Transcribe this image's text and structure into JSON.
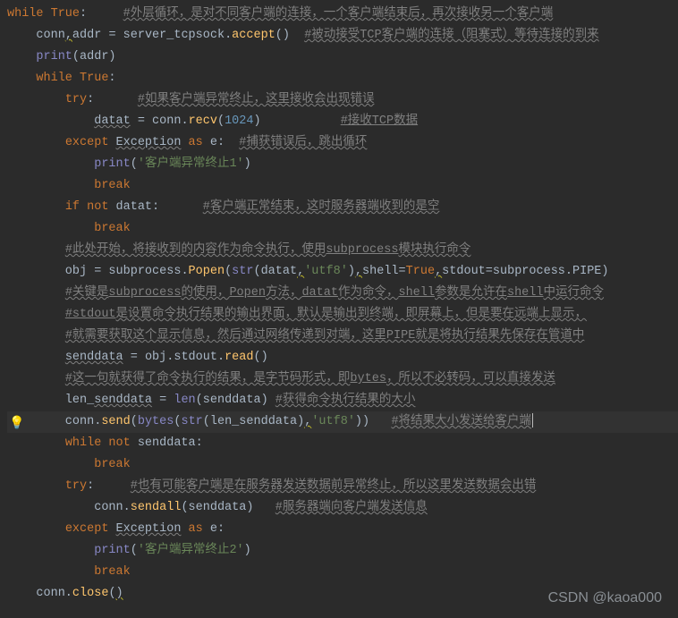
{
  "watermark": "CSDN @kaoa000",
  "bulb_line_index": 19,
  "code": {
    "lines": [
      [
        [
          "kw",
          "while "
        ],
        [
          "kw",
          "True"
        ],
        [
          "p",
          ":"
        ],
        [
          "p",
          "     "
        ],
        [
          "com wavy",
          "#外层循环，是对不同客户端的连接，一个客户端结束后，再次接收另一个客户端"
        ]
      ],
      [
        [
          "p",
          "    conn"
        ],
        [
          "warn",
          ","
        ],
        [
          "p",
          "addr "
        ],
        [
          "op",
          "="
        ],
        [
          "p",
          " server_tcpsock."
        ],
        [
          "fn",
          "accept"
        ],
        [
          "p",
          "()  "
        ],
        [
          "com wavy",
          "#被动接受TCP客户端的连接（阻塞式）等待连接的到来"
        ]
      ],
      [
        [
          "p",
          "    "
        ],
        [
          "builtin",
          "print"
        ],
        [
          "p",
          "(addr)"
        ]
      ],
      [
        [
          "p",
          "    "
        ],
        [
          "kw",
          "while "
        ],
        [
          "kw",
          "True"
        ],
        [
          "p",
          ":"
        ]
      ],
      [
        [
          "p",
          "        "
        ],
        [
          "kw",
          "try"
        ],
        [
          "p",
          ":"
        ],
        [
          "p",
          "      "
        ],
        [
          "com wavy",
          "#如果客户端异常终止，这里接收会出现错误"
        ]
      ],
      [
        [
          "p",
          "            "
        ],
        [
          "wavy",
          "datat"
        ],
        [
          "p",
          " "
        ],
        [
          "op",
          "="
        ],
        [
          "p",
          " conn."
        ],
        [
          "fn",
          "recv"
        ],
        [
          "p",
          "("
        ],
        [
          "num",
          "1024"
        ],
        [
          "p",
          ")           "
        ],
        [
          "com wavy u",
          "#接收TCP数据"
        ]
      ],
      [
        [
          "p",
          "        "
        ],
        [
          "kw",
          "except "
        ],
        [
          "p wavy",
          "Exception"
        ],
        [
          "kw",
          " as "
        ],
        [
          "p",
          "e:  "
        ],
        [
          "com wavy",
          "#捕获错误后，跳出循环"
        ]
      ],
      [
        [
          "p",
          "            "
        ],
        [
          "builtin",
          "print"
        ],
        [
          "p",
          "("
        ],
        [
          "str",
          "'客户端异常终止1'"
        ],
        [
          "p",
          ")"
        ]
      ],
      [
        [
          "p",
          "            "
        ],
        [
          "kw",
          "break"
        ]
      ],
      [
        [
          "p",
          "        "
        ],
        [
          "kw",
          "if not "
        ],
        [
          "p",
          "datat:      "
        ],
        [
          "com wavy",
          "#客户端正常结束，这时服务器端收到的是空"
        ]
      ],
      [
        [
          "p",
          "            "
        ],
        [
          "kw",
          "break"
        ]
      ],
      [
        [
          "p",
          "        "
        ],
        [
          "com wavy",
          "#此处开始，将接收到的内容作为命令执行，使用"
        ],
        [
          "com wavy u",
          "subprocess"
        ],
        [
          "com wavy",
          "模块执行命令"
        ]
      ],
      [
        [
          "p",
          "        obj "
        ],
        [
          "op",
          "="
        ],
        [
          "p",
          " subprocess."
        ],
        [
          "fn",
          "Popen"
        ],
        [
          "p",
          "("
        ],
        [
          "builtin",
          "str"
        ],
        [
          "p",
          "(datat"
        ],
        [
          "warn",
          ","
        ],
        [
          "str",
          "'utf8'"
        ],
        [
          "p",
          ")"
        ],
        [
          "warn",
          ","
        ],
        [
          "p",
          "shell"
        ],
        [
          "op",
          "="
        ],
        [
          "kw",
          "True"
        ],
        [
          "warn",
          ","
        ],
        [
          "p",
          "stdout"
        ],
        [
          "op",
          "="
        ],
        [
          "p",
          "subprocess.PIPE)"
        ]
      ],
      [
        [
          "p",
          "        "
        ],
        [
          "com wavy",
          "#关键是"
        ],
        [
          "com wavy u",
          "subprocess"
        ],
        [
          "com wavy",
          "的使用，"
        ],
        [
          "com wavy u",
          "Popen"
        ],
        [
          "com wavy",
          "方法，"
        ],
        [
          "com wavy u",
          "datat"
        ],
        [
          "com wavy",
          "作为命令，"
        ],
        [
          "com wavy u",
          "shell"
        ],
        [
          "com wavy",
          "参数是允许在"
        ],
        [
          "com wavy u",
          "shell"
        ],
        [
          "com wavy",
          "中运行命令"
        ]
      ],
      [
        [
          "p",
          "        "
        ],
        [
          "com wavy u",
          "#stdout"
        ],
        [
          "com wavy",
          "是设置命令执行结果的输出界面，默认是输出到终端，即屏幕上，但是要在远端上显示，"
        ]
      ],
      [
        [
          "p",
          "        "
        ],
        [
          "com wavy",
          "#就需要获取这个显示信息，然后通过网络传递到对端，这里PIPE就是将执行结果先保存在管道中"
        ]
      ],
      [
        [
          "p",
          "        "
        ],
        [
          "p wavy",
          "senddata"
        ],
        [
          "p",
          " "
        ],
        [
          "op",
          "="
        ],
        [
          "p",
          " obj.stdout."
        ],
        [
          "fn",
          "read"
        ],
        [
          "p",
          "()"
        ]
      ],
      [
        [
          "p",
          "        "
        ],
        [
          "com wavy",
          "#这一句就获得了命令执行的结果，是字节码形式，即"
        ],
        [
          "com wavy u",
          "bytes"
        ],
        [
          "com wavy",
          "，所以不必转码，可以直接发送"
        ]
      ],
      [
        [
          "p",
          "        len_"
        ],
        [
          "p wavy",
          "senddata"
        ],
        [
          "p",
          " "
        ],
        [
          "op",
          "="
        ],
        [
          "p",
          " "
        ],
        [
          "builtin",
          "len"
        ],
        [
          "p",
          "(senddata) "
        ],
        [
          "com wavy",
          "#获得命令执行结果的大小"
        ]
      ],
      [
        [
          "p",
          "        conn."
        ],
        [
          "fn",
          "send"
        ],
        [
          "p",
          "("
        ],
        [
          "builtin",
          "bytes"
        ],
        [
          "p",
          "("
        ],
        [
          "builtin",
          "str"
        ],
        [
          "p",
          "(len_senddata)"
        ],
        [
          "warn",
          ","
        ],
        [
          "str",
          "'utf8'"
        ],
        [
          "p",
          "))   "
        ],
        [
          "com wavy",
          "#将结果大小发送给客户端"
        ],
        [
          "caret",
          ""
        ]
      ],
      [
        [
          "p",
          "        "
        ],
        [
          "kw",
          "while not "
        ],
        [
          "p",
          "senddata:"
        ]
      ],
      [
        [
          "p",
          "            "
        ],
        [
          "kw",
          "break"
        ]
      ],
      [
        [
          "p",
          "        "
        ],
        [
          "kw",
          "try"
        ],
        [
          "p",
          ":"
        ],
        [
          "p",
          "     "
        ],
        [
          "com wavy",
          "#也有可能客户端是在服务器发送数据前异常终止，所以这里发送数据会出错"
        ]
      ],
      [
        [
          "p",
          "            conn."
        ],
        [
          "fn",
          "sendall"
        ],
        [
          "p",
          "(senddata)   "
        ],
        [
          "com wavy",
          "#服务器端向客户端发送信息"
        ]
      ],
      [
        [
          "p",
          "        "
        ],
        [
          "kw",
          "except "
        ],
        [
          "p wavy",
          "Exception"
        ],
        [
          "kw",
          " as "
        ],
        [
          "p",
          "e:"
        ]
      ],
      [
        [
          "p",
          "            "
        ],
        [
          "builtin",
          "print"
        ],
        [
          "p",
          "("
        ],
        [
          "str",
          "'客户端异常终止2'"
        ],
        [
          "p",
          ")"
        ]
      ],
      [
        [
          "p",
          "            "
        ],
        [
          "kw",
          "break"
        ]
      ],
      [
        [
          "p",
          "    conn."
        ],
        [
          "fn",
          "close"
        ],
        [
          "p",
          "("
        ],
        [
          "p warn",
          ")"
        ]
      ]
    ]
  }
}
